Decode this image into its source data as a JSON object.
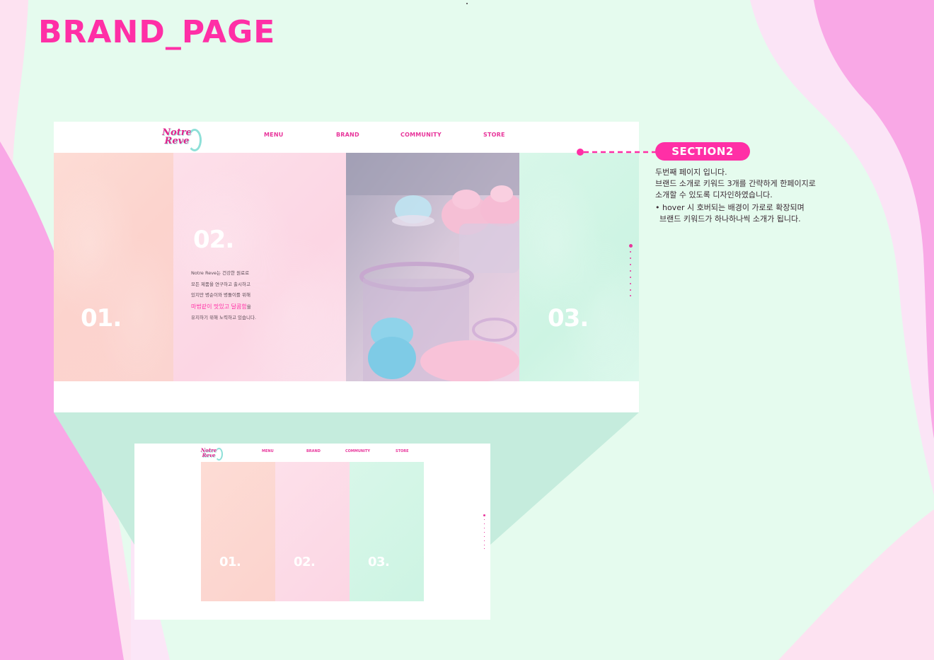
{
  "page": {
    "title": "BRAND_PAGE"
  },
  "colors": {
    "accent": "#ff2fa6",
    "mint": "#e5fbee",
    "pink": "#f9a8e6"
  },
  "site": {
    "logo": "Notre\nReve",
    "nav": [
      "MENU",
      "BRAND",
      "COMMUNITY",
      "STORE"
    ]
  },
  "section": {
    "numbers": [
      "01.",
      "02.",
      "03."
    ],
    "description": {
      "line1": "Notre Reve는 건강한 원료로",
      "line2": "모든 제품을 연구하고 출시하고",
      "line3": "있지만 병순이와 병돌이를 위해",
      "highlight": "마법같이 맛있고 달콤함",
      "highlight_suffix": "을",
      "line5": "유지하기 위해 노력하고 있습니다."
    }
  },
  "annotation": {
    "badge": "SECTION2",
    "line1": "두번째 페이지 입니다.",
    "line2": "브랜드 소개로 키워드 3개를 간략하게 한페이지로",
    "line3": "소개할 수 있도록 디자인하였습니다.",
    "bullet1": "• hover 시 호버되는 배경이 가로로 확장되며",
    "bullet2": "브랜드 키워드가 하나하나씩 소개가 됩니다."
  }
}
